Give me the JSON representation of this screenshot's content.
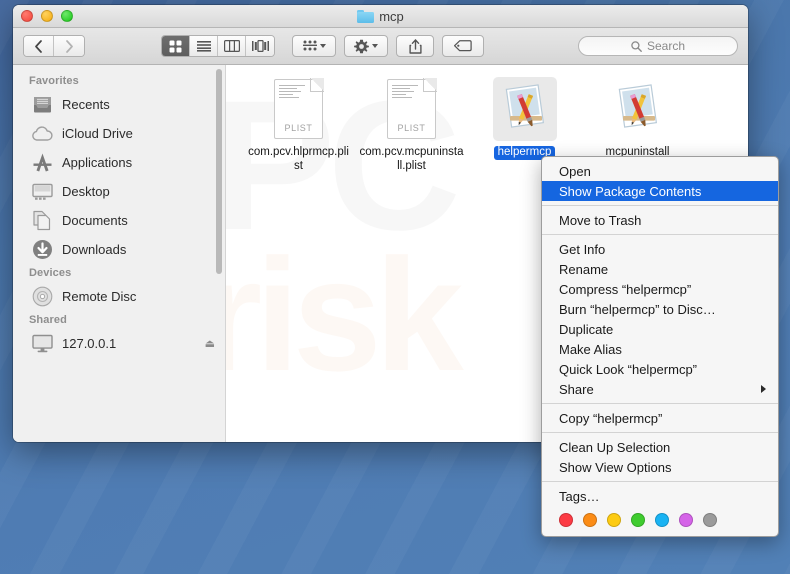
{
  "window": {
    "title": "mcp",
    "title_icon": "folder-icon",
    "traffic_lights": [
      "close-button",
      "minimize-button",
      "maximize-button"
    ]
  },
  "toolbar": {
    "nav_back": "chevron-left-icon",
    "nav_forward": "chevron-right-icon",
    "views": [
      {
        "name": "icon-view",
        "icon": "grid-icon",
        "active": true
      },
      {
        "name": "list-view",
        "icon": "list-icon",
        "active": false
      },
      {
        "name": "column-view",
        "icon": "columns-icon",
        "active": false
      },
      {
        "name": "gallery-view",
        "icon": "gallery-icon",
        "active": false
      }
    ],
    "arrange_button": "arrange-icon",
    "action_button": "gear-icon",
    "share_button": "share-icon",
    "tags_button": "tag-icon"
  },
  "search": {
    "placeholder": "Search",
    "icon": "search-icon"
  },
  "sidebar": {
    "sections": [
      {
        "header": "Favorites",
        "items": [
          {
            "label": "Recents",
            "icon": "recents-icon"
          },
          {
            "label": "iCloud Drive",
            "icon": "cloud-icon"
          },
          {
            "label": "Applications",
            "icon": "applications-icon"
          },
          {
            "label": "Desktop",
            "icon": "desktop-icon"
          },
          {
            "label": "Documents",
            "icon": "documents-icon"
          },
          {
            "label": "Downloads",
            "icon": "downloads-icon"
          }
        ]
      },
      {
        "header": "Devices",
        "items": [
          {
            "label": "Remote Disc",
            "icon": "disc-icon"
          }
        ]
      },
      {
        "header": "Shared",
        "items": [
          {
            "label": "127.0.0.1",
            "icon": "display-icon",
            "eject": "⏏"
          }
        ]
      }
    ]
  },
  "content": {
    "watermark_top": "PC",
    "watermark_bottom": "risk",
    "files": [
      {
        "name": "com.pcv.hlprmcp.plist",
        "type": "plist",
        "ext_label": "PLIST",
        "selected": false
      },
      {
        "name": "com.pcv.mcpuninstall.plist",
        "type": "plist",
        "ext_label": "PLIST",
        "selected": false
      },
      {
        "name": "helpermcp",
        "type": "app",
        "ext_label": "",
        "selected": true
      },
      {
        "name": "mcpuninstall",
        "type": "app",
        "ext_label": "",
        "selected": false
      }
    ]
  },
  "context_menu": {
    "groups": [
      {
        "items": [
          {
            "label": "Open",
            "highlight": false,
            "submenu": false
          },
          {
            "label": "Show Package Contents",
            "highlight": true,
            "submenu": false
          }
        ]
      },
      {
        "items": [
          {
            "label": "Move to Trash",
            "highlight": false,
            "submenu": false
          }
        ]
      },
      {
        "items": [
          {
            "label": "Get Info",
            "highlight": false,
            "submenu": false
          },
          {
            "label": "Rename",
            "highlight": false,
            "submenu": false
          },
          {
            "label": "Compress “helpermcp”",
            "highlight": false,
            "submenu": false
          },
          {
            "label": "Burn “helpermcp” to Disc…",
            "highlight": false,
            "submenu": false
          },
          {
            "label": "Duplicate",
            "highlight": false,
            "submenu": false
          },
          {
            "label": "Make Alias",
            "highlight": false,
            "submenu": false
          },
          {
            "label": "Quick Look “helpermcp”",
            "highlight": false,
            "submenu": false
          },
          {
            "label": "Share",
            "highlight": false,
            "submenu": true
          }
        ]
      },
      {
        "items": [
          {
            "label": "Copy “helpermcp”",
            "highlight": false,
            "submenu": false
          }
        ]
      },
      {
        "items": [
          {
            "label": "Clean Up Selection",
            "highlight": false,
            "submenu": false
          },
          {
            "label": "Show View Options",
            "highlight": false,
            "submenu": false
          }
        ]
      },
      {
        "items": [
          {
            "label": "Tags…",
            "highlight": false,
            "submenu": false
          }
        ]
      }
    ],
    "tag_colors": [
      "#fc3b44",
      "#fb8c16",
      "#fdcb12",
      "#3fcc2f",
      "#19b3f3",
      "#d564e8",
      "#9b9b9b"
    ],
    "highlight_color": "#1566e0"
  }
}
